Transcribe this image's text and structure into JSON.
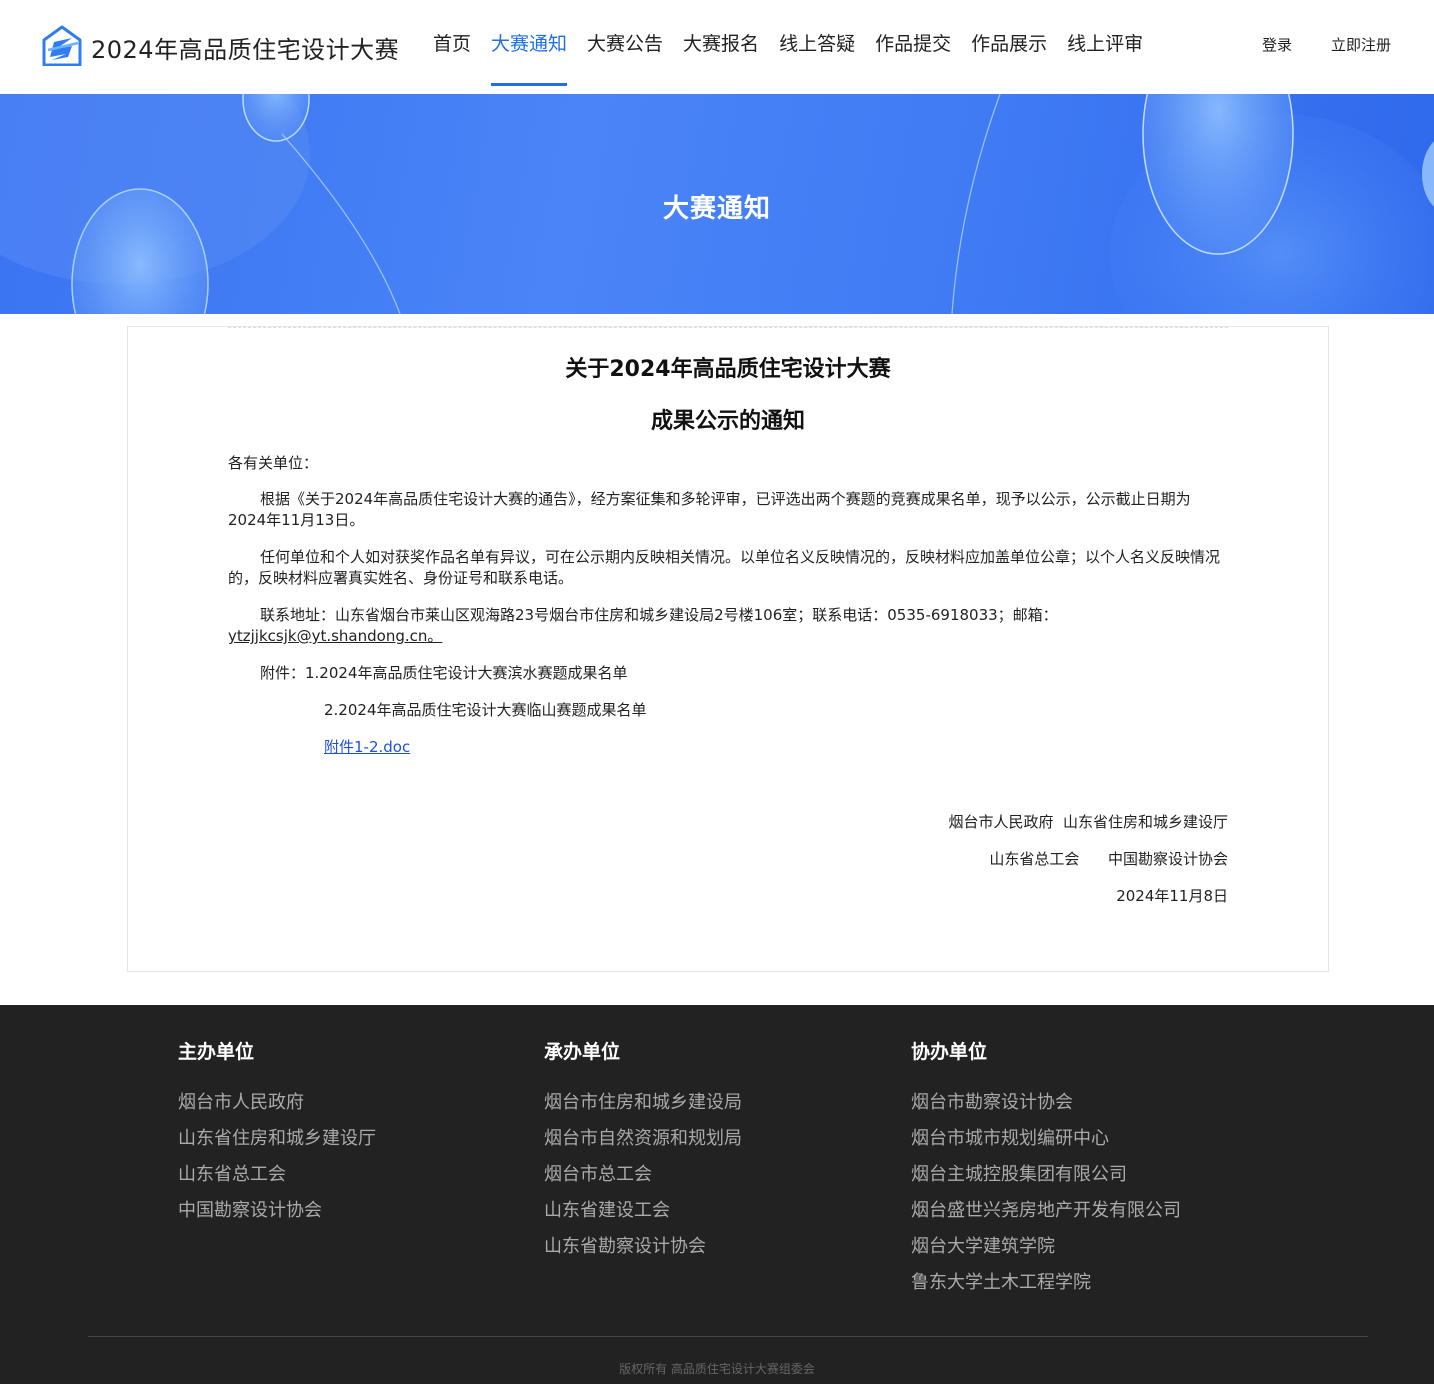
{
  "header": {
    "site_title": "2024年高品质住宅设计大赛",
    "nav": [
      {
        "label": "首页",
        "active": false
      },
      {
        "label": "大赛通知",
        "active": true
      },
      {
        "label": "大赛公告",
        "active": false
      },
      {
        "label": "大赛报名",
        "active": false
      },
      {
        "label": "线上答疑",
        "active": false
      },
      {
        "label": "作品提交",
        "active": false
      },
      {
        "label": "作品展示",
        "active": false
      },
      {
        "label": "线上评审",
        "active": false
      }
    ],
    "login": "登录",
    "register": "立即注册"
  },
  "banner": {
    "title": "大赛通知"
  },
  "notice": {
    "title_line1": "关于2024年高品质住宅设计大赛",
    "title_line2": "成果公示的通知",
    "salutation": "各有关单位：",
    "para1": "根据《关于2024年高品质住宅设计大赛的通告》，经方案征集和多轮评审，已评选出两个赛题的竞赛成果名单，现予以公示，公示截止日期为2024年11月13日。",
    "para2": "任何单位和个人如对获奖作品名单有异议，可在公示期内反映相关情况。以单位名义反映情况的，反映材料应加盖单位公章；以个人名义反映情况的，反映材料应署真实姓名、身份证号和联系电话。",
    "contact_prefix": "联系地址：山东省烟台市莱山区观海路23号烟台市住房和城乡建设局2号楼106室；联系电话：0535-6918033；邮箱：",
    "email": "ytzjjkcsjk@yt.shandong.cn。",
    "attachment1": "附件：1.2024年高品质住宅设计大赛滨水赛题成果名单",
    "attachment2": "2.2024年高品质住宅设计大赛临山赛题成果名单",
    "attachment_link": "附件1-2.doc",
    "signers_line1": "烟台市人民政府  山东省住房和城乡建设厅",
    "signers_line2": "山东省总工会      中国勘察设计协会",
    "date": "2024年11月8日"
  },
  "footer": {
    "columns": [
      {
        "heading": "主办单位",
        "items": [
          "烟台市人民政府",
          "山东省住房和城乡建设厅",
          "山东省总工会",
          "中国勘察设计协会"
        ]
      },
      {
        "heading": "承办单位",
        "items": [
          "烟台市住房和城乡建设局",
          "烟台市自然资源和规划局",
          "烟台市总工会",
          "山东省建设工会",
          "山东省勘察设计协会"
        ]
      },
      {
        "heading": "协办单位",
        "items": [
          "烟台市勘察设计协会",
          "烟台市城市规划编研中心",
          "烟台主城控股集团有限公司",
          "烟台盛世兴尧房地产开发有限公司",
          "烟台大学建筑学院",
          "鲁东大学土木工程学院"
        ]
      }
    ],
    "copyright": "版权所有  高品质住宅设计大赛组委会"
  },
  "colors": {
    "accent": "#1f6fe5",
    "banner_blue": "#3f7af4",
    "footer_bg": "#222222",
    "link_blue": "#1f4fe0"
  },
  "icons": {
    "logo": "house-logo-icon"
  }
}
